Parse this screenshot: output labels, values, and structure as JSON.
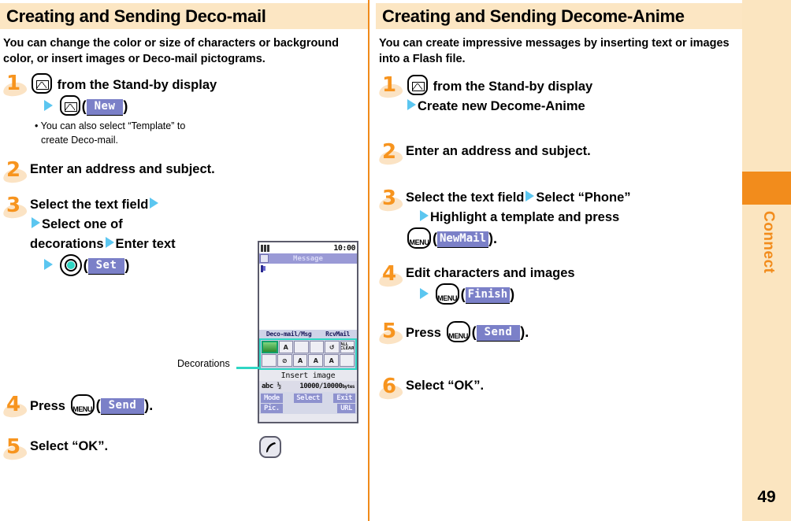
{
  "left": {
    "heading": "Creating and Sending Deco-mail",
    "intro": "You can change the color or size of characters or background color, or insert images or Deco-mail pictograms.",
    "steps": [
      {
        "num": "1",
        "line1_after_key": "from the Stand-by display",
        "line2_chip": "New",
        "note": [
          "• You can also select “Template” to",
          "create Deco-mail."
        ]
      },
      {
        "num": "2",
        "text": "Enter an address and subject."
      },
      {
        "num": "3",
        "line1": "Select the text field",
        "line2": "Select one of",
        "line3a": "decorations",
        "line3b": "Enter text",
        "line4_chip": "Set"
      },
      {
        "num": "4",
        "prefix": "Press",
        "chip": "Send",
        "suffix": ")."
      },
      {
        "num": "5",
        "text": "Select “OK”."
      }
    ],
    "callout": "Decorations"
  },
  "right": {
    "heading": "Creating and Sending Decome-Anime",
    "intro": "You can create impressive messages by inserting text or images into a Flash file.",
    "steps": [
      {
        "num": "1",
        "line1_after_key": "from the Stand-by display",
        "line2": "Create new Decome-Anime"
      },
      {
        "num": "2",
        "text": "Enter an address and subject."
      },
      {
        "num": "3",
        "line1a": "Select the text field",
        "line1b": "Select “Phone”",
        "line2": "Highlight a template and press",
        "line3_chip": "NewMail",
        "line3_suffix": ")."
      },
      {
        "num": "4",
        "line1": "Edit characters and images",
        "line2_chip": "Finish"
      },
      {
        "num": "5",
        "prefix": "Press",
        "chip": "Send",
        "suffix": ")."
      },
      {
        "num": "6",
        "text": "Select “OK”."
      }
    ]
  },
  "phone": {
    "clock": "10:00",
    "title": "Message",
    "soft_left": "Deco-mail/Msg",
    "soft_right": "RcvMail",
    "palette_row1": [
      "",
      "A",
      "",
      "",
      "↺",
      "ALL CLEAR"
    ],
    "palette_row2": [
      "",
      "⊘",
      "A",
      "A",
      "A",
      ""
    ],
    "caption": "Insert image",
    "info_left": "abc ½",
    "info_right": "10000/10000",
    "info_unit": "bytes",
    "key_mode": "Mode",
    "key_pic": "Pic.",
    "key_select": "Select",
    "key_exit": "Exit",
    "key_url": "URL"
  },
  "sidebar": {
    "label": "Connect",
    "page_number": "49",
    "accent": "#f28c1c",
    "tint": "#fbe5c0"
  },
  "icons": {
    "mail_key": "mail-key-icon",
    "phone_key": "phone-key-icon",
    "menu_key": "menu-key-icon",
    "center_key": "center-select-key-icon",
    "arrow": "blue-triangle-arrow-icon"
  }
}
